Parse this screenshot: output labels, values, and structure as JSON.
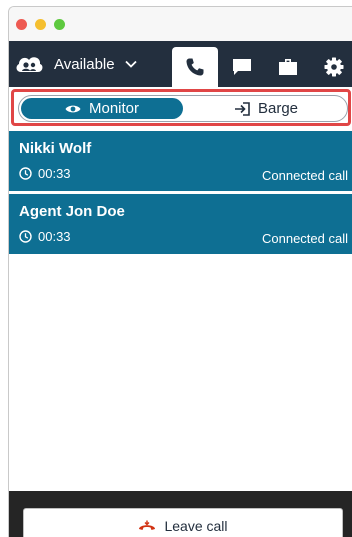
{
  "toolbar": {
    "status_label": "Available",
    "status_icon": "cloud-agent-icon",
    "tabs": [
      {
        "icon": "phone-icon",
        "active": true
      },
      {
        "icon": "chat-icon",
        "active": false
      },
      {
        "icon": "briefcase-icon",
        "active": false
      },
      {
        "icon": "gear-icon",
        "active": false
      }
    ]
  },
  "mode": {
    "monitor_label": "Monitor",
    "barge_label": "Barge",
    "selected": "Monitor"
  },
  "calls": [
    {
      "name": "Nikki Wolf",
      "duration": "00:33",
      "status": "Connected call"
    },
    {
      "name": "Agent Jon Doe",
      "duration": "00:33",
      "status": "Connected call"
    }
  ],
  "footer": {
    "leave_label": "Leave call"
  },
  "colors": {
    "toolbar_bg": "#232f3e",
    "accent": "#0e6f93",
    "highlight": "#e04646",
    "leave_icon": "#d13212",
    "footer_bg": "#252525"
  }
}
